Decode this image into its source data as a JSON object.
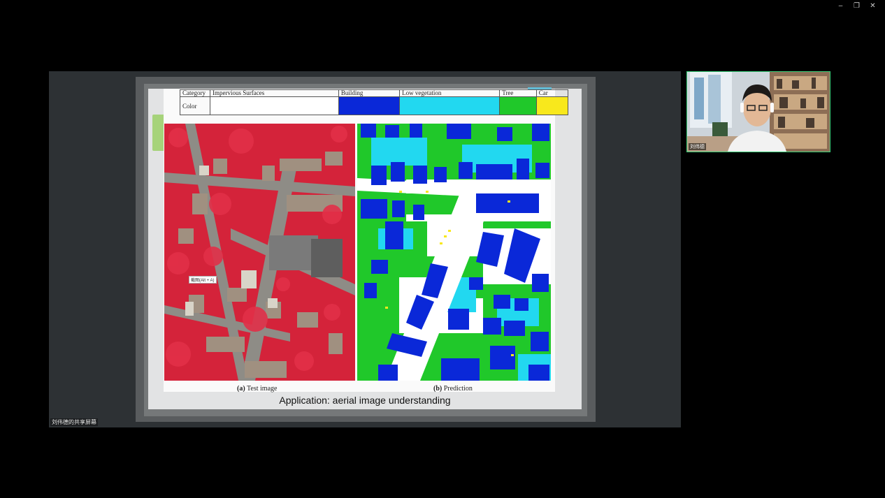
{
  "window": {
    "minimize_icon": "minimize-icon",
    "restore_icon": "restore-icon",
    "close_icon": "close-icon"
  },
  "share": {
    "sharer_label": "刘伟德的共享屏幕"
  },
  "slide": {
    "legend": {
      "header_label": "Category",
      "row_label": "Color",
      "categories": [
        {
          "name": "Impervious Surfaces",
          "color": "#ffffff"
        },
        {
          "name": "Building",
          "color": "#0a28d8"
        },
        {
          "name": "Low vegetation",
          "color": "#22d8f0"
        },
        {
          "name": "Tree",
          "color": "#20c82a"
        },
        {
          "name": "Car",
          "color": "#f8e81c"
        }
      ]
    },
    "caption_a_label": "(a)",
    "caption_a_text": "Test image",
    "caption_b_label": "(b)",
    "caption_b_text": "Prediction",
    "title": "Application: aerial image understanding",
    "tooltip": "截图(Alt + A)"
  },
  "camera": {
    "participant_name": "刘伟德"
  },
  "colors": {
    "panel_bg": "#2d3134",
    "camera_border": "#3ad07a",
    "aerial_red": "#d4233a"
  }
}
